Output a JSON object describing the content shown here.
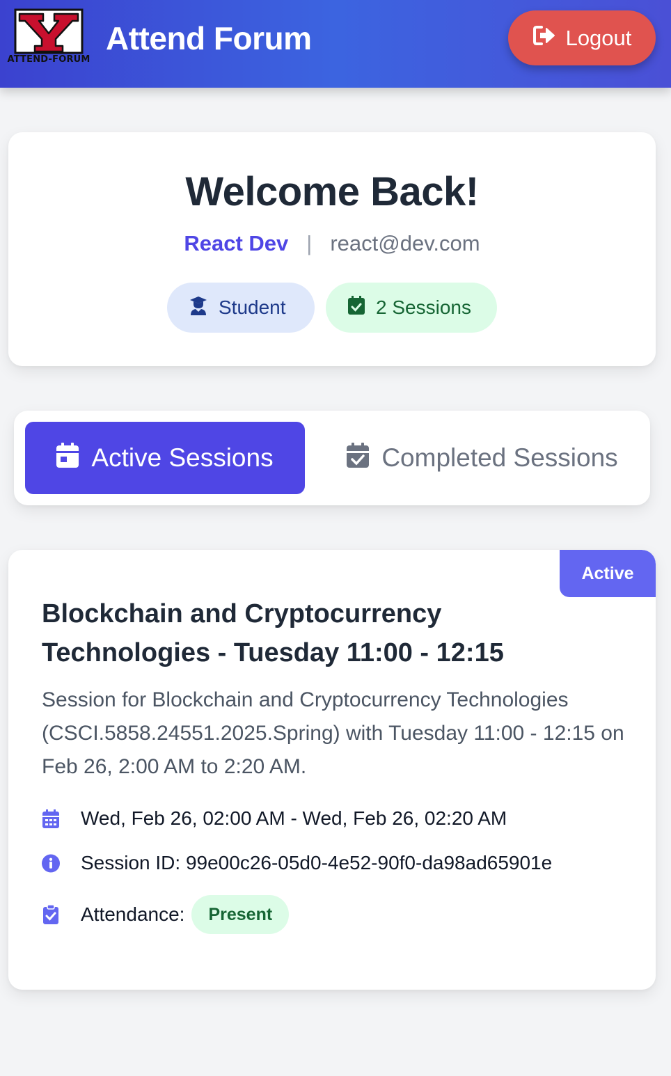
{
  "header": {
    "logo_text": "ATTEND-FORUM",
    "title": "Attend Forum",
    "logout_label": "Logout"
  },
  "welcome": {
    "title": "Welcome Back!",
    "user_name": "React Dev",
    "separator": "|",
    "email": "react@dev.com",
    "role_badge": "Student",
    "sessions_badge": "2 Sessions"
  },
  "tabs": {
    "active_label": "Active Sessions",
    "completed_label": "Completed Sessions"
  },
  "session": {
    "status": "Active",
    "title": "Blockchain and Cryptocurrency Technologies - Tuesday 11:00 - 12:15",
    "description": "Session for Blockchain and Cryptocurrency Technologies (CSCI.5858.24551.2025.Spring) with Tuesday 11:00 - 12:15 on Feb 26, 2:00 AM to 2:20 AM.",
    "datetime": "Wed, Feb 26, 02:00 AM - Wed, Feb 26, 02:20 AM",
    "session_id": "Session ID: 99e00c26-05d0-4e52-90f0-da98ad65901e",
    "attendance_label": "Attendance:",
    "attendance_value": "Present"
  },
  "icons": {
    "logo": "y-logo-icon",
    "logout": "sign-out-icon",
    "role": "user-graduate-icon",
    "sessions": "calendar-check-icon",
    "active_tab": "calendar-icon",
    "completed_tab": "calendar-check-icon",
    "datetime": "calendar-days-icon",
    "session_id": "info-circle-icon",
    "attendance": "clipboard-check-icon"
  },
  "colors": {
    "primary": "#4f46e5",
    "logout": "#e0534f",
    "present_bg": "#dcfce7",
    "present_text": "#166534"
  }
}
